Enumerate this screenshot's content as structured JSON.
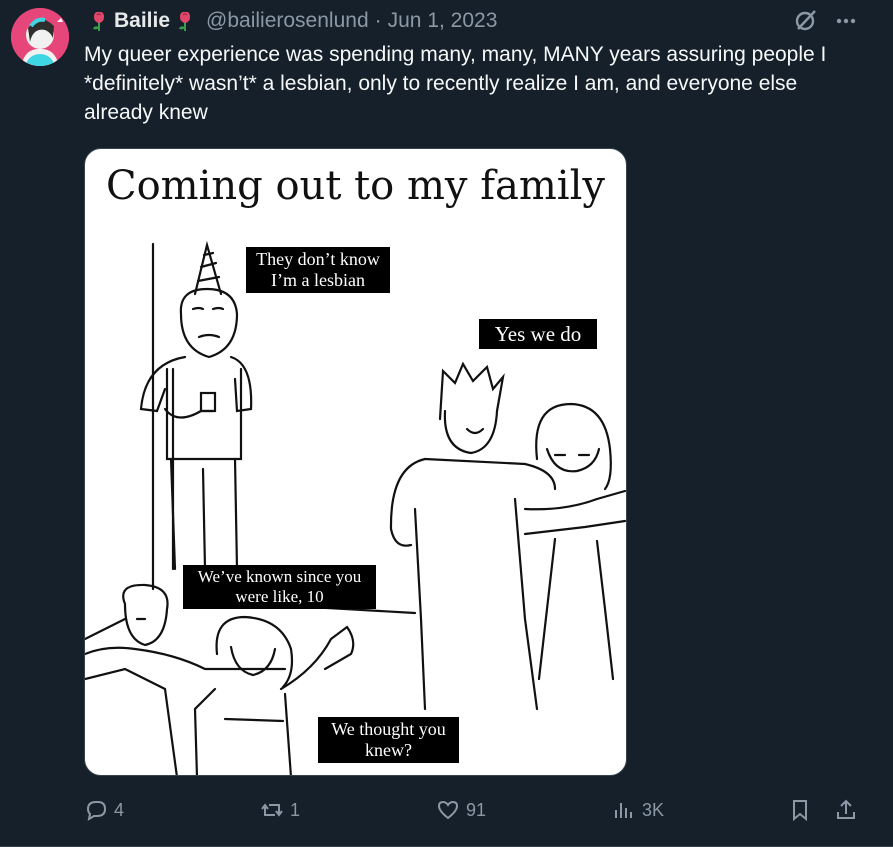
{
  "post": {
    "author_name": "Bailie",
    "author_handle": "@bailierosenlund",
    "separator": "·",
    "date": "Jun 1, 2023",
    "text": "My queer experience was spending many, many, MANY years assuring people I *definitely* wasn’t* a lesbian, only to recently realize I am, and everyone else already knew"
  },
  "meme": {
    "title": "Coming out to my family",
    "captions": {
      "c1_line1": "They don’t know",
      "c1_line2": "I’m a lesbian",
      "c2": "Yes we do",
      "c3_line1": "We’ve known since you",
      "c3_line2": "were like, 10",
      "c4_line1": "We thought you",
      "c4_line2": "knew?"
    }
  },
  "actions": {
    "replies": "4",
    "reposts": "1",
    "likes": "91",
    "views": "3K"
  },
  "icons": {
    "emoji": "rose-emoji",
    "grok": "grok-icon",
    "more": "more-icon",
    "reply": "reply-icon",
    "repost": "repost-icon",
    "like": "heart-icon",
    "views": "views-icon",
    "bookmark": "bookmark-icon",
    "share": "share-icon"
  },
  "colors": {
    "background": "#15202b",
    "text": "#f7f9f9",
    "muted": "#8b98a5",
    "avatar": "#e6467a"
  }
}
